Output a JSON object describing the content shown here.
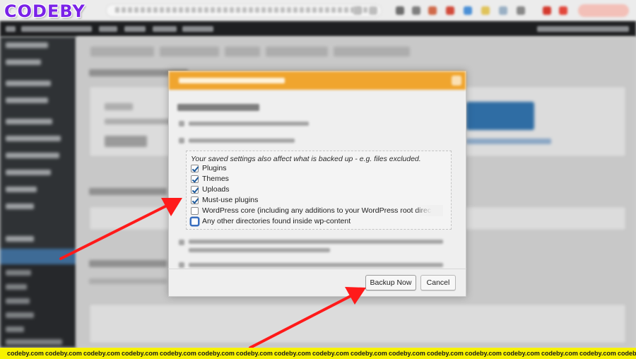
{
  "brand": {
    "logo_text": "CODEBY"
  },
  "dialog": {
    "settings_note": "Your saved settings also affect what is backed up - e.g. files excluded.",
    "options": [
      {
        "label": "Plugins",
        "checked": true,
        "focused": false
      },
      {
        "label": "Themes",
        "checked": true,
        "focused": false
      },
      {
        "label": "Uploads",
        "checked": true,
        "focused": false
      },
      {
        "label": "Must-use plugins",
        "checked": true,
        "focused": false
      },
      {
        "label": "WordPress core (including any additions to your WordPress root directory)",
        "checked": false,
        "focused": false
      },
      {
        "label": "Any other directories found inside wp-content",
        "checked": false,
        "focused": true
      }
    ],
    "backup_now_label": "Backup Now",
    "cancel_label": "Cancel",
    "header_color": "#f0a52e"
  },
  "annotations": {
    "arrow_color": "#ff1a1a"
  },
  "watermark": {
    "text": "codeby.com",
    "color": "#f7f200"
  }
}
